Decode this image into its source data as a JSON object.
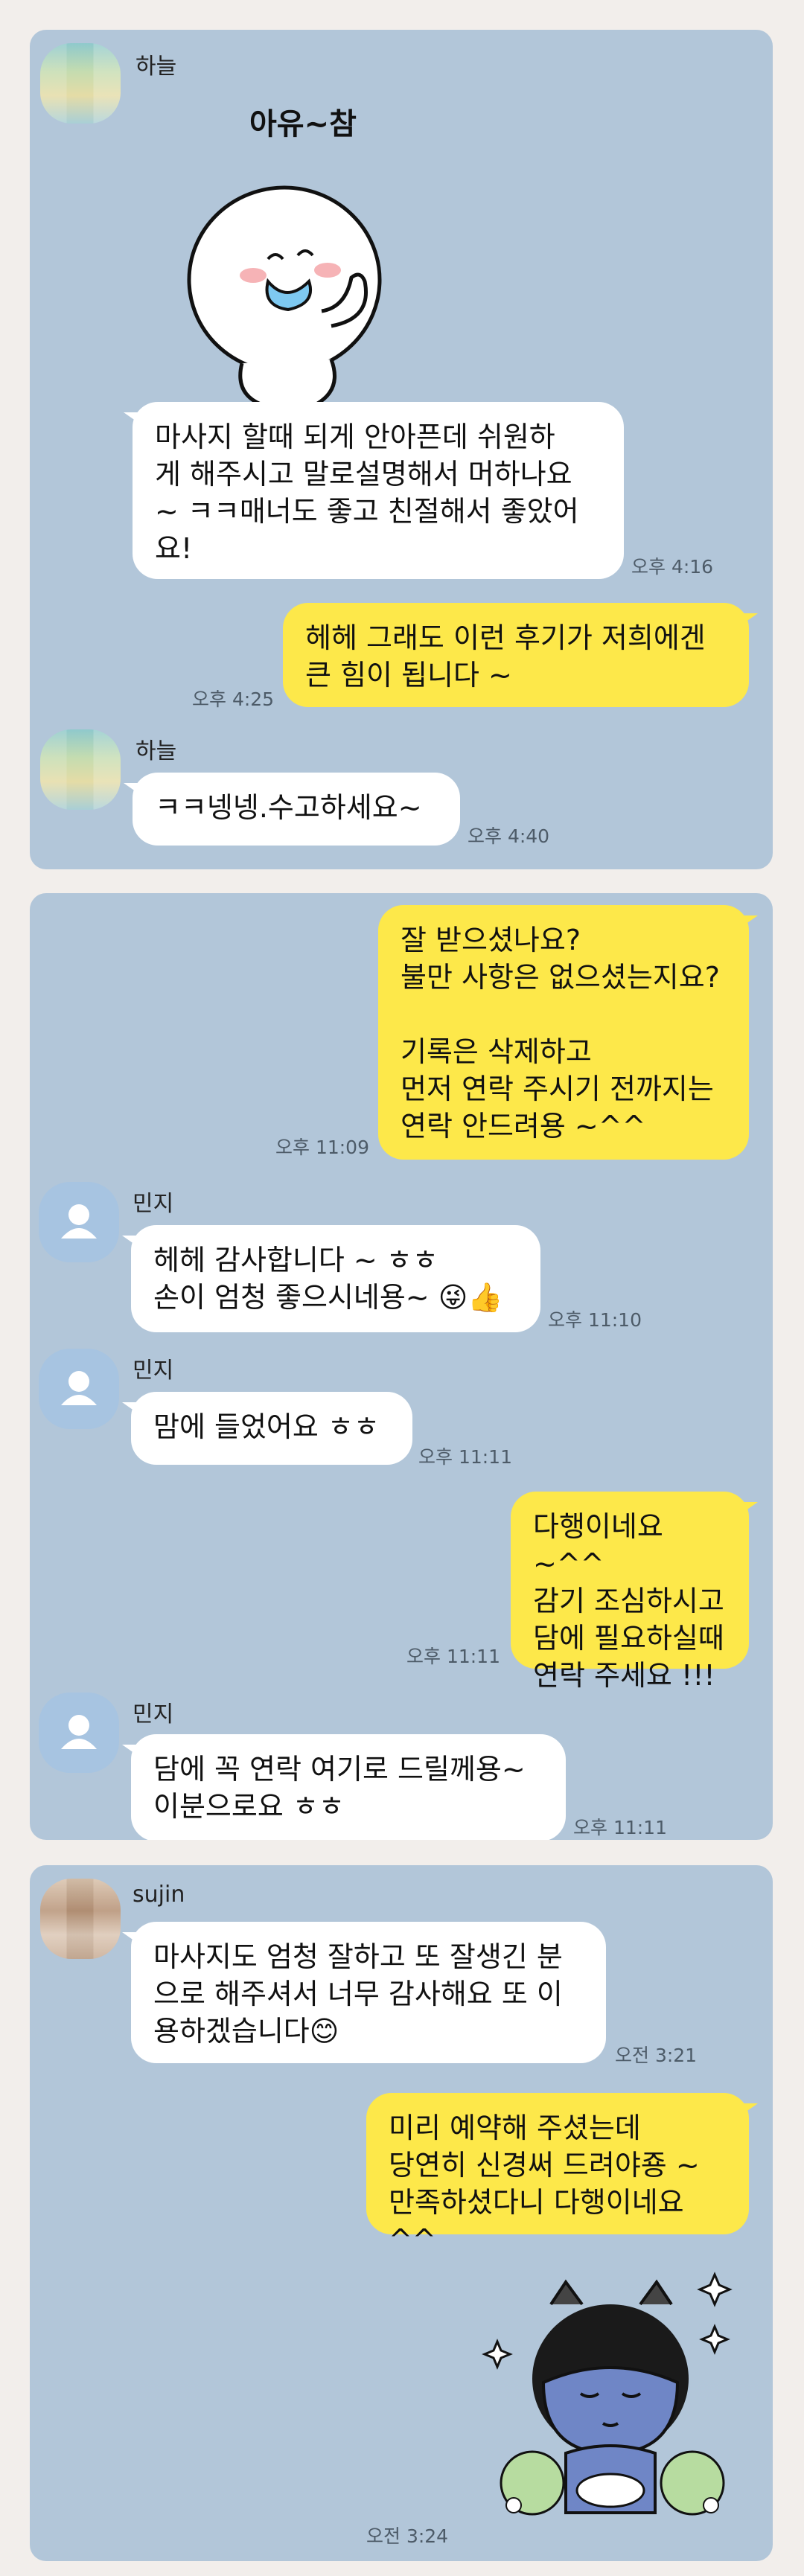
{
  "panel1": {
    "sender1": "하늘",
    "sticker_text": "아유~참",
    "msg1": "마사지 할때 되게 안아픈데 쉬원하\n게 해주시고 말로설명해서 머하나요\n~ ㅋㅋ매너도 좋고 친절해서 좋았어\n요!",
    "time1": "오후 4:16",
    "reply1": "헤헤 그래도 이런 후기가 저희에겐\n큰 힘이 됩니다 ~",
    "reply1_time": "오후 4:25",
    "sender2": "하늘",
    "msg2": "ㅋㅋ넹넹.수고하세요~",
    "time2": "오후 4:40"
  },
  "panel2": {
    "reply1": "잘 받으셨나요?\n불만 사항은 없으셨는지요?\n\n기록은 삭제하고\n먼저 연락 주시기 전까지는\n연락 안드려용 ~^^",
    "reply1_time": "오후 11:09",
    "sender1": "민지",
    "msg1": "헤헤 감사합니다 ~ ㅎㅎ\n손이 엄청 좋으시네용~ 😜👍",
    "time1": "오후 11:10",
    "sender2": "민지",
    "msg2": "맘에 들었어요 ㅎㅎ",
    "time2": "오후 11:11",
    "reply2": "다행이네요 ~^^\n감기 조심하시고\n담에 필요하실때\n연락 주세요 !!!",
    "reply2_time": "오후 11:11",
    "sender3": "민지",
    "msg3": "담에 꼭 연락 여기로 드릴께용~\n이분으로요 ㅎㅎ",
    "time3": "오후 11:11"
  },
  "panel3": {
    "sender1": "sujin",
    "msg1": "마사지도 엄청 잘하고 또 잘생긴 분\n으로 해주셔서 너무 감사해요 또 이\n용하겠습니다😊",
    "time1": "오전 3:21",
    "reply1": "미리 예약해 주셨는데\n당연히 신경써 드려야죵 ~\n만족하셨다니 다행이네요 ^^",
    "time2": "오전 3:24"
  },
  "colors": {
    "chat_bg": "#b2c6d9",
    "page_bg": "#f2eeeb",
    "my_bubble": "#fde84a",
    "their_bubble": "#ffffff"
  }
}
